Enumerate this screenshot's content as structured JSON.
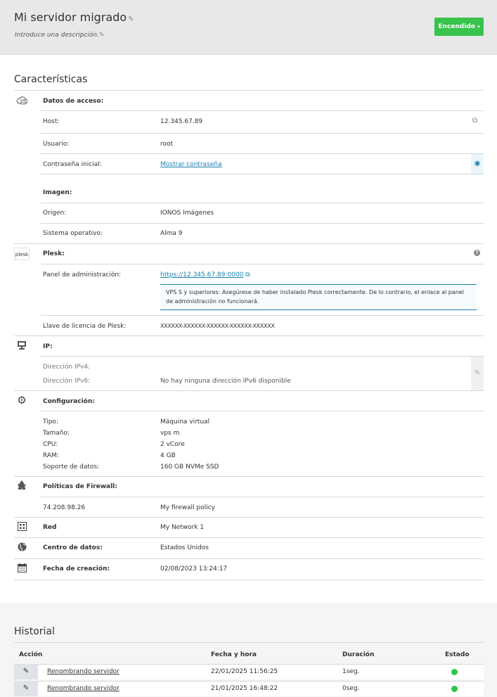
{
  "header": {
    "title": "Mi servidor migrado",
    "description_placeholder": "Introduce una descripción.",
    "power_button": "Encendido",
    "colors": {
      "power": "#37c34c",
      "link": "#1a7fb0"
    }
  },
  "characteristics": {
    "title": "Características",
    "access": {
      "heading": "Datos de acceso:",
      "host_label": "Host:",
      "host_value": "12.345.67.89",
      "user_label": "Usuario:",
      "user_value": "root",
      "pass_label": "Contraseña inicial:",
      "pass_link": "Mostrar contraseña"
    },
    "image": {
      "heading": "Imagen:",
      "origin_label": "Origen:",
      "origin_value": "IONOS Imágenes",
      "os_label": "Sistema operativo:",
      "os_value": "Alma 9"
    },
    "plesk": {
      "logo_text": "plesk",
      "heading": "Plesk:",
      "panel_label": "Panel de administración:",
      "panel_link": "https://12.345.67.89:0000",
      "info_text": "VPS S y superiores: Asegúrese de haber instalado Plesk correctamente. De lo contrario, el enlace al panel de administración no funcionará.",
      "license_label": "Llave de licencia de Plesk:",
      "license_value": "XXXXXX-XXXXXX-XXXXXX-XXXXXX-XXXXXX"
    },
    "ip": {
      "heading": "IP:",
      "ipv4_label": "Dirección IPv4:",
      "ipv6_label": "Dirección IPv6:",
      "ipv6_value": "No hay ninguna dirección IPv6 disponible"
    },
    "config": {
      "heading": "Configuración:",
      "type_label": "Tipo:",
      "type_value": "Máquina virtual",
      "size_label": "Tamaño:",
      "size_value": "vps m",
      "cpu_label": "CPU:",
      "cpu_value": "2 vCore",
      "ram_label": "RAM:",
      "ram_value": "4 GB",
      "storage_label": "Soporte de datos:",
      "storage_value": "160 GB NVMe SSD"
    },
    "firewall": {
      "heading": "Políticas de Firewall:",
      "ip": "74.208.98.26",
      "policy": "My firewall policy"
    },
    "network": {
      "label": "Red",
      "value": "My Network 1"
    },
    "datacenter": {
      "label": "Centro de datos:",
      "value": "Estados Unidos"
    },
    "created": {
      "label": "Fecha de creación:",
      "value": "02/08/2023 13:24:17"
    }
  },
  "history": {
    "title": "Historial",
    "columns": [
      "Acción",
      "Fecha y hora",
      "Duración",
      "Estado"
    ],
    "rows": [
      {
        "action": "Renombrando servidor",
        "datetime": "22/01/2025 11:56:25",
        "duration": "1seg.",
        "status_color": "#2fc24a"
      },
      {
        "action": "Renombrando servidor",
        "datetime": "21/01/2025 16:48:22",
        "duration": "0seg.",
        "status_color": "#2fc24a"
      }
    ]
  }
}
